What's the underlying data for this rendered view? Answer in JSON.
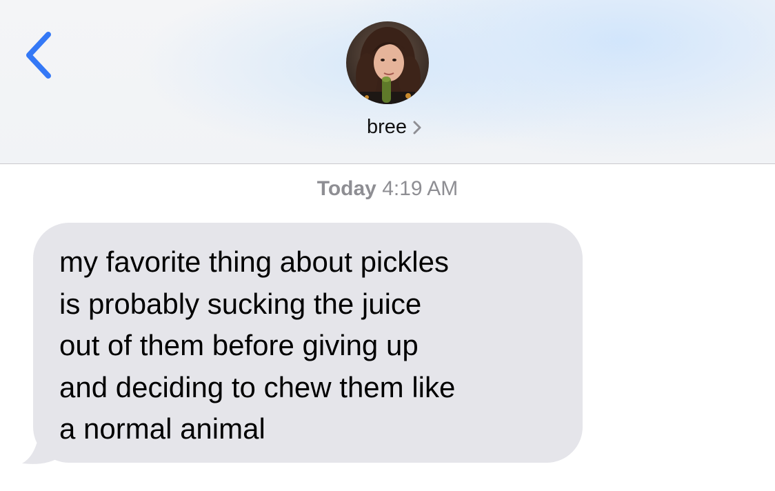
{
  "header": {
    "back_icon": "chevron-left-icon",
    "avatar_icon": "contact-photo",
    "contact_name": "bree",
    "chevron_icon": "chevron-right-icon"
  },
  "conversation": {
    "timestamp_day": "Today",
    "timestamp_time": "4:19 AM",
    "messages": [
      {
        "sender": "bree",
        "lines": [
          "my favorite thing about pickles",
          "is probably sucking the juice",
          "out of them before giving up",
          "and deciding to chew them like",
          "a normal animal"
        ]
      }
    ]
  },
  "colors": {
    "accent": "#3478f6",
    "bubble_incoming": "#e5e5ea",
    "timestamp_text": "#8e8e93"
  }
}
